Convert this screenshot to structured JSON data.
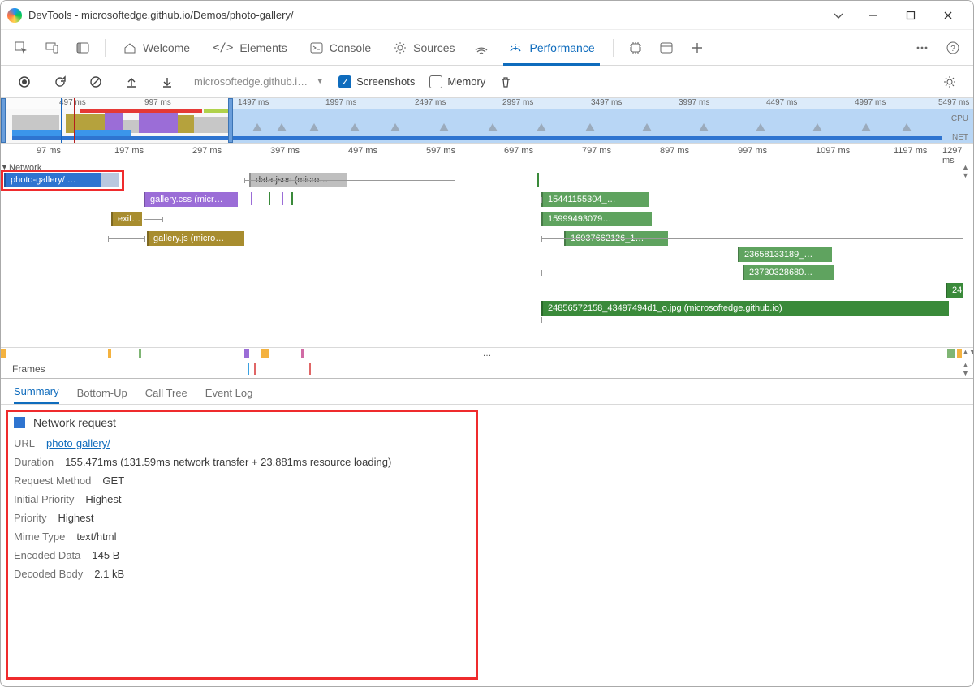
{
  "window": {
    "title": "DevTools - microsoftedge.github.io/Demos/photo-gallery/"
  },
  "tabs": {
    "welcome": "Welcome",
    "elements": "Elements",
    "console": "Console",
    "sources": "Sources",
    "performance": "Performance"
  },
  "toolbar": {
    "url_short": "microsoftedge.github.i…",
    "screenshots": "Screenshots",
    "memory": "Memory"
  },
  "overview_ticks": [
    "497 ms",
    "997 ms",
    "1497 ms",
    "1997 ms",
    "2497 ms",
    "2997 ms",
    "3497 ms",
    "3997 ms",
    "4497 ms",
    "4997 ms",
    "5497 ms"
  ],
  "overview_labels": {
    "cpu": "CPU",
    "net": "NET"
  },
  "ruler_ticks": [
    "97 ms",
    "197 ms",
    "297 ms",
    "397 ms",
    "497 ms",
    "597 ms",
    "697 ms",
    "797 ms",
    "897 ms",
    "997 ms",
    "1097 ms",
    "1197 ms",
    "1297 ms"
  ],
  "network": {
    "header": "Network",
    "bars": {
      "selected": "photo-gallery/ …",
      "css": "gallery.css (micr…",
      "exif": "exif…",
      "js": "gallery.js (micro…",
      "json": "data.json (micro…",
      "img1": "15441155304_…",
      "img2": "15999493079…",
      "img3": "16037662126_1…",
      "img4": "23658133189_…",
      "img5": "23730328680…",
      "img6": "24",
      "img7": "24856572158_43497494d1_o.jpg (microsoftedge.github.io)"
    }
  },
  "frames_label": "Frames",
  "ellipsis": "…",
  "detail_tabs": {
    "summary": "Summary",
    "bottomup": "Bottom-Up",
    "calltree": "Call Tree",
    "eventlog": "Event Log"
  },
  "summary": {
    "title": "Network request",
    "url_label": "URL",
    "url_value": "photo-gallery/",
    "duration_label": "Duration",
    "duration_value": "155.471ms (131.59ms network transfer + 23.881ms resource loading)",
    "method_label": "Request Method",
    "method_value": "GET",
    "initprio_label": "Initial Priority",
    "initprio_value": "Highest",
    "prio_label": "Priority",
    "prio_value": "Highest",
    "mime_label": "Mime Type",
    "mime_value": "text/html",
    "enc_label": "Encoded Data",
    "enc_value": "145 B",
    "dec_label": "Decoded Body",
    "dec_value": "2.1 kB"
  }
}
